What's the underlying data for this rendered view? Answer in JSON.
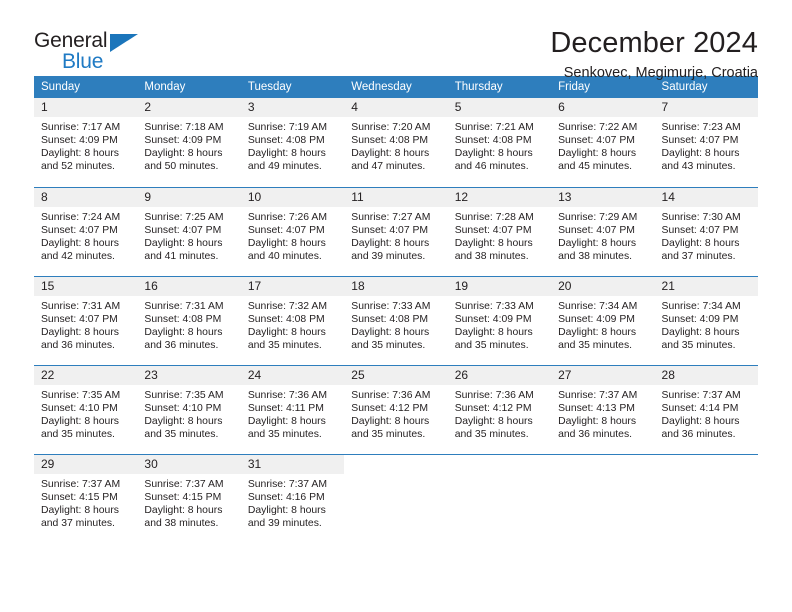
{
  "brand": {
    "name_part1": "General",
    "name_part2": "Blue",
    "accent_color": "#1b75bb"
  },
  "header": {
    "title": "December 2024",
    "subtitle": "Senkovec, Megimurje, Croatia"
  },
  "calendar": {
    "header_bg": "#2e7ebd",
    "daynum_bg": "#f0f0f0",
    "weekday_names": [
      "Sunday",
      "Monday",
      "Tuesday",
      "Wednesday",
      "Thursday",
      "Friday",
      "Saturday"
    ],
    "weeks": [
      [
        {
          "day": "1",
          "sunrise": "Sunrise: 7:17 AM",
          "sunset": "Sunset: 4:09 PM",
          "daylight_line1": "Daylight: 8 hours",
          "daylight_line2": "and 52 minutes."
        },
        {
          "day": "2",
          "sunrise": "Sunrise: 7:18 AM",
          "sunset": "Sunset: 4:09 PM",
          "daylight_line1": "Daylight: 8 hours",
          "daylight_line2": "and 50 minutes."
        },
        {
          "day": "3",
          "sunrise": "Sunrise: 7:19 AM",
          "sunset": "Sunset: 4:08 PM",
          "daylight_line1": "Daylight: 8 hours",
          "daylight_line2": "and 49 minutes."
        },
        {
          "day": "4",
          "sunrise": "Sunrise: 7:20 AM",
          "sunset": "Sunset: 4:08 PM",
          "daylight_line1": "Daylight: 8 hours",
          "daylight_line2": "and 47 minutes."
        },
        {
          "day": "5",
          "sunrise": "Sunrise: 7:21 AM",
          "sunset": "Sunset: 4:08 PM",
          "daylight_line1": "Daylight: 8 hours",
          "daylight_line2": "and 46 minutes."
        },
        {
          "day": "6",
          "sunrise": "Sunrise: 7:22 AM",
          "sunset": "Sunset: 4:07 PM",
          "daylight_line1": "Daylight: 8 hours",
          "daylight_line2": "and 45 minutes."
        },
        {
          "day": "7",
          "sunrise": "Sunrise: 7:23 AM",
          "sunset": "Sunset: 4:07 PM",
          "daylight_line1": "Daylight: 8 hours",
          "daylight_line2": "and 43 minutes."
        }
      ],
      [
        {
          "day": "8",
          "sunrise": "Sunrise: 7:24 AM",
          "sunset": "Sunset: 4:07 PM",
          "daylight_line1": "Daylight: 8 hours",
          "daylight_line2": "and 42 minutes."
        },
        {
          "day": "9",
          "sunrise": "Sunrise: 7:25 AM",
          "sunset": "Sunset: 4:07 PM",
          "daylight_line1": "Daylight: 8 hours",
          "daylight_line2": "and 41 minutes."
        },
        {
          "day": "10",
          "sunrise": "Sunrise: 7:26 AM",
          "sunset": "Sunset: 4:07 PM",
          "daylight_line1": "Daylight: 8 hours",
          "daylight_line2": "and 40 minutes."
        },
        {
          "day": "11",
          "sunrise": "Sunrise: 7:27 AM",
          "sunset": "Sunset: 4:07 PM",
          "daylight_line1": "Daylight: 8 hours",
          "daylight_line2": "and 39 minutes."
        },
        {
          "day": "12",
          "sunrise": "Sunrise: 7:28 AM",
          "sunset": "Sunset: 4:07 PM",
          "daylight_line1": "Daylight: 8 hours",
          "daylight_line2": "and 38 minutes."
        },
        {
          "day": "13",
          "sunrise": "Sunrise: 7:29 AM",
          "sunset": "Sunset: 4:07 PM",
          "daylight_line1": "Daylight: 8 hours",
          "daylight_line2": "and 38 minutes."
        },
        {
          "day": "14",
          "sunrise": "Sunrise: 7:30 AM",
          "sunset": "Sunset: 4:07 PM",
          "daylight_line1": "Daylight: 8 hours",
          "daylight_line2": "and 37 minutes."
        }
      ],
      [
        {
          "day": "15",
          "sunrise": "Sunrise: 7:31 AM",
          "sunset": "Sunset: 4:07 PM",
          "daylight_line1": "Daylight: 8 hours",
          "daylight_line2": "and 36 minutes."
        },
        {
          "day": "16",
          "sunrise": "Sunrise: 7:31 AM",
          "sunset": "Sunset: 4:08 PM",
          "daylight_line1": "Daylight: 8 hours",
          "daylight_line2": "and 36 minutes."
        },
        {
          "day": "17",
          "sunrise": "Sunrise: 7:32 AM",
          "sunset": "Sunset: 4:08 PM",
          "daylight_line1": "Daylight: 8 hours",
          "daylight_line2": "and 35 minutes."
        },
        {
          "day": "18",
          "sunrise": "Sunrise: 7:33 AM",
          "sunset": "Sunset: 4:08 PM",
          "daylight_line1": "Daylight: 8 hours",
          "daylight_line2": "and 35 minutes."
        },
        {
          "day": "19",
          "sunrise": "Sunrise: 7:33 AM",
          "sunset": "Sunset: 4:09 PM",
          "daylight_line1": "Daylight: 8 hours",
          "daylight_line2": "and 35 minutes."
        },
        {
          "day": "20",
          "sunrise": "Sunrise: 7:34 AM",
          "sunset": "Sunset: 4:09 PM",
          "daylight_line1": "Daylight: 8 hours",
          "daylight_line2": "and 35 minutes."
        },
        {
          "day": "21",
          "sunrise": "Sunrise: 7:34 AM",
          "sunset": "Sunset: 4:09 PM",
          "daylight_line1": "Daylight: 8 hours",
          "daylight_line2": "and 35 minutes."
        }
      ],
      [
        {
          "day": "22",
          "sunrise": "Sunrise: 7:35 AM",
          "sunset": "Sunset: 4:10 PM",
          "daylight_line1": "Daylight: 8 hours",
          "daylight_line2": "and 35 minutes."
        },
        {
          "day": "23",
          "sunrise": "Sunrise: 7:35 AM",
          "sunset": "Sunset: 4:10 PM",
          "daylight_line1": "Daylight: 8 hours",
          "daylight_line2": "and 35 minutes."
        },
        {
          "day": "24",
          "sunrise": "Sunrise: 7:36 AM",
          "sunset": "Sunset: 4:11 PM",
          "daylight_line1": "Daylight: 8 hours",
          "daylight_line2": "and 35 minutes."
        },
        {
          "day": "25",
          "sunrise": "Sunrise: 7:36 AM",
          "sunset": "Sunset: 4:12 PM",
          "daylight_line1": "Daylight: 8 hours",
          "daylight_line2": "and 35 minutes."
        },
        {
          "day": "26",
          "sunrise": "Sunrise: 7:36 AM",
          "sunset": "Sunset: 4:12 PM",
          "daylight_line1": "Daylight: 8 hours",
          "daylight_line2": "and 35 minutes."
        },
        {
          "day": "27",
          "sunrise": "Sunrise: 7:37 AM",
          "sunset": "Sunset: 4:13 PM",
          "daylight_line1": "Daylight: 8 hours",
          "daylight_line2": "and 36 minutes."
        },
        {
          "day": "28",
          "sunrise": "Sunrise: 7:37 AM",
          "sunset": "Sunset: 4:14 PM",
          "daylight_line1": "Daylight: 8 hours",
          "daylight_line2": "and 36 minutes."
        }
      ],
      [
        {
          "day": "29",
          "sunrise": "Sunrise: 7:37 AM",
          "sunset": "Sunset: 4:15 PM",
          "daylight_line1": "Daylight: 8 hours",
          "daylight_line2": "and 37 minutes."
        },
        {
          "day": "30",
          "sunrise": "Sunrise: 7:37 AM",
          "sunset": "Sunset: 4:15 PM",
          "daylight_line1": "Daylight: 8 hours",
          "daylight_line2": "and 38 minutes."
        },
        {
          "day": "31",
          "sunrise": "Sunrise: 7:37 AM",
          "sunset": "Sunset: 4:16 PM",
          "daylight_line1": "Daylight: 8 hours",
          "daylight_line2": "and 39 minutes."
        },
        {
          "day": "",
          "sunrise": "",
          "sunset": "",
          "daylight_line1": "",
          "daylight_line2": ""
        },
        {
          "day": "",
          "sunrise": "",
          "sunset": "",
          "daylight_line1": "",
          "daylight_line2": ""
        },
        {
          "day": "",
          "sunrise": "",
          "sunset": "",
          "daylight_line1": "",
          "daylight_line2": ""
        },
        {
          "day": "",
          "sunrise": "",
          "sunset": "",
          "daylight_line1": "",
          "daylight_line2": ""
        }
      ]
    ]
  }
}
